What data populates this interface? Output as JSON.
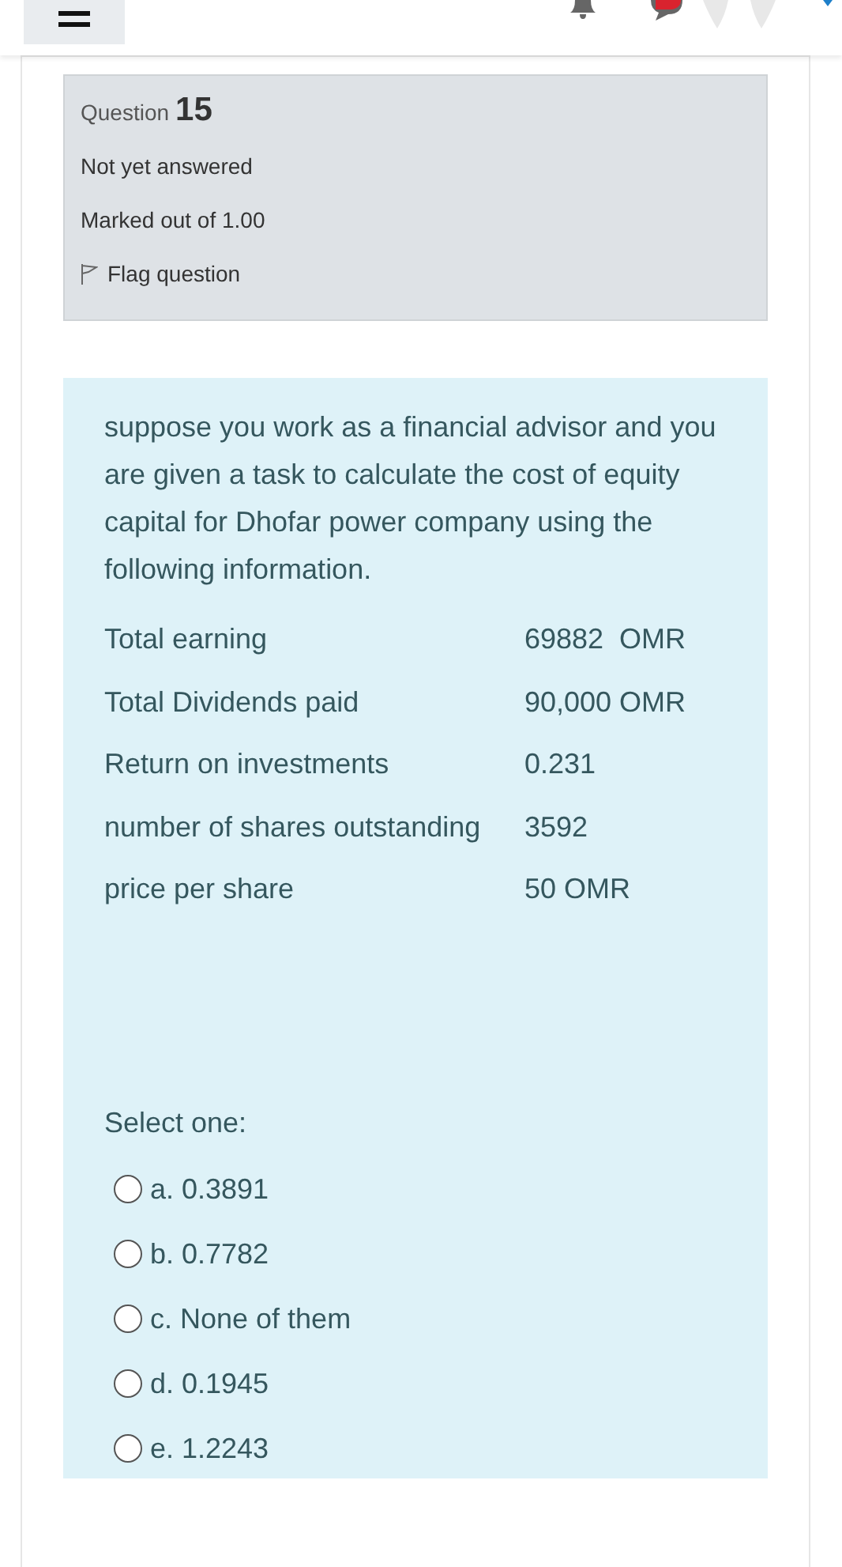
{
  "question_info": {
    "label": "Question",
    "number": "15",
    "status": "Not yet answered",
    "marks": "Marked out of 1.00",
    "flag": {
      "label": "Flag question",
      "flagged": false
    }
  },
  "question": {
    "text": "suppose you work as a financial advisor and you are given a task to calculate the cost of equity capital for Dhofar power company using the following information.",
    "data": [
      {
        "label": "Total earning",
        "value": "69882  OMR"
      },
      {
        "label": "Total Dividends paid",
        "value": "90,000 OMR"
      },
      {
        "label": "Return on investments",
        "value": "0.231"
      },
      {
        "label": "number of shares outstanding",
        "value": "3592"
      },
      {
        "label": "price per share",
        "value": "50 OMR"
      }
    ],
    "prompt": "Select one:",
    "options": [
      {
        "label": "a. 0.3891",
        "selected": false
      },
      {
        "label": "b. 0.7782",
        "selected": false
      },
      {
        "label": "c. None of them",
        "selected": false
      },
      {
        "label": "d. 0.1945",
        "selected": false
      },
      {
        "label": "e. 1.2243",
        "selected": false
      }
    ]
  }
}
